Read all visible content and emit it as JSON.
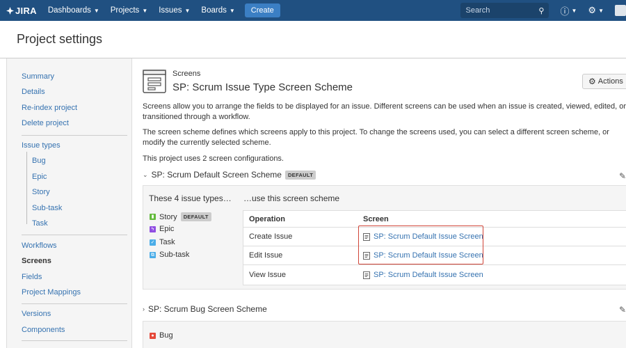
{
  "nav": {
    "logo": "JIRA",
    "items": [
      "Dashboards",
      "Projects",
      "Issues",
      "Boards"
    ],
    "create": "Create",
    "search_placeholder": "Search"
  },
  "page": {
    "title": "Project settings"
  },
  "sidebar": {
    "group1": [
      "Summary",
      "Details",
      "Re-index project",
      "Delete project"
    ],
    "issue_types_label": "Issue types",
    "issue_types": [
      "Bug",
      "Epic",
      "Story",
      "Sub-task",
      "Task"
    ],
    "group3": [
      "Workflows",
      "Screens",
      "Fields",
      "Project Mappings"
    ],
    "active": "Screens",
    "group4": [
      "Versions",
      "Components"
    ]
  },
  "main": {
    "small_label": "Screens",
    "title": "SP: Scrum Issue Type Screen Scheme",
    "actions": "Actions",
    "p1": "Screens allow you to arrange the fields to be displayed for an issue. Different screens can be used when an issue is created, viewed, edited, or transitioned through a workflow.",
    "p2": "The screen scheme defines which screens apply to this project. To change the screens used, you can select a different screen scheme, or modify the currently selected scheme.",
    "p3": "This project uses 2 screen configurations."
  },
  "scheme1": {
    "name": "SP: Scrum Default Screen Scheme",
    "badge": "DEFAULT",
    "types_head": "These 4 issue types…",
    "use_head": "…use this screen scheme",
    "types": [
      {
        "name": "Story",
        "badge": "DEFAULT",
        "color": "#63ba3c"
      },
      {
        "name": "Epic",
        "badge": "",
        "color": "#904ee2"
      },
      {
        "name": "Task",
        "badge": "",
        "color": "#4bade8"
      },
      {
        "name": "Sub-task",
        "badge": "",
        "color": "#4bade8"
      }
    ],
    "columns": {
      "operation": "Operation",
      "screen": "Screen"
    },
    "rows": [
      {
        "operation": "Create Issue",
        "screen": "SP: Scrum Default Issue Screen"
      },
      {
        "operation": "Edit Issue",
        "screen": "SP: Scrum Default Issue Screen"
      },
      {
        "operation": "View Issue",
        "screen": "SP: Scrum Default Issue Screen"
      }
    ]
  },
  "scheme2": {
    "name": "SP: Scrum Bug Screen Scheme",
    "types": [
      {
        "name": "Bug",
        "color": "#e5493a"
      }
    ]
  },
  "colors": {
    "nav": "#205081",
    "link": "#3572b0",
    "highlight": "#d04437"
  }
}
